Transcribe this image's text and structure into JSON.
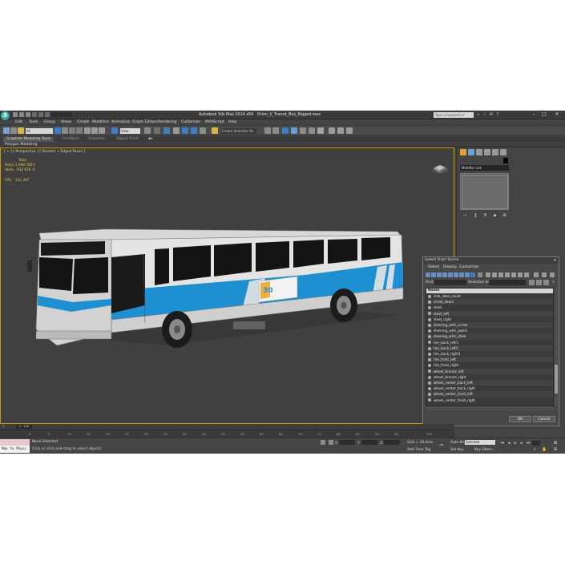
{
  "app": {
    "logo_glyph": "3",
    "title": "Autodesk 3ds Max 2014 x64",
    "file": "Orion_V_Transit_Bus_Rigged.max",
    "search_placeholder": "Type a keyword or phrase"
  },
  "menu": [
    "Edit",
    "Tools",
    "Group",
    "Views",
    "Create",
    "Modifiers",
    "Animation",
    "Graph Editors",
    "Rendering",
    "Customize",
    "MAXScript",
    "Help"
  ],
  "toolbar": {
    "filter_value": "All",
    "refcoord_value": "View",
    "selection_set_value": "Create Selection Se"
  },
  "ribbon": {
    "tabs": [
      "Graphite Modeling Tools",
      "Freeform",
      "Selection",
      "Object Paint"
    ],
    "subtab": "Polygon Modeling"
  },
  "viewport": {
    "label": "[ + ] [ Perspective ] [ Shaded + Edged Faces ]",
    "stats": {
      "total_label": "Total",
      "polys_label": "Polys:",
      "polys_value": "1 698 785",
      "polys_sel": "0",
      "verts_label": "Verts:",
      "verts_value": "932 978",
      "verts_sel": "0",
      "fps_label": "FPS:",
      "fps_value": "121,397"
    },
    "bus_ad_number": "30"
  },
  "command_panel": {
    "modifier_list": "Modifier List"
  },
  "dialog": {
    "title": "Select From Scene",
    "menus": [
      "Select",
      "Display",
      "Customize"
    ],
    "find_label": "Find:",
    "selection_set_label": "Selection Set:",
    "list_header": "Name",
    "items": [
      "side_label_route",
      "small_doors",
      "steel",
      "steel_left",
      "steel_right",
      "steering_whlr_screw",
      "steering_whlr_patch",
      "steering_whlr_steel",
      "tire_back_left1",
      "tire_back_left2",
      "tire_back_right1",
      "tire_front_left",
      "tire_front_right",
      "wheel_bronze_left",
      "wheel_bronze_right",
      "wheel_center_back_left",
      "wheel_center_back_right",
      "wheel_center_front_left",
      "wheel_center_front_right"
    ],
    "ok_label": "OK",
    "cancel_label": "Cancel"
  },
  "timeline": {
    "frame_counter": "0 / 100",
    "ticks": [
      "0",
      "5",
      "10",
      "15",
      "20",
      "25",
      "30",
      "35",
      "40",
      "45",
      "50",
      "55",
      "60",
      "65",
      "70",
      "75",
      "80",
      "85",
      "90",
      "95",
      "100"
    ]
  },
  "status": {
    "maxscript_label": "Max to Physc",
    "selection_text": "None Selected",
    "prompt_text": "Click or click-and-drag to select objects",
    "x_label": "X:",
    "y_label": "Y:",
    "z_label": "Z:",
    "grid_text": "Grid = 10,0cm",
    "add_time_tag": "Add Time Tag",
    "auto_key": "Auto Key",
    "set_key": "Set Key",
    "selected_value": "Selected",
    "key_filters": "Key Filters..."
  },
  "colors": {
    "ui_dark": "#444444",
    "viewport_border": "#c8a000",
    "stats_text": "#e6c84a",
    "bus_blue": "#1e8fd0",
    "highlight_blue": "#3d7fc7"
  }
}
